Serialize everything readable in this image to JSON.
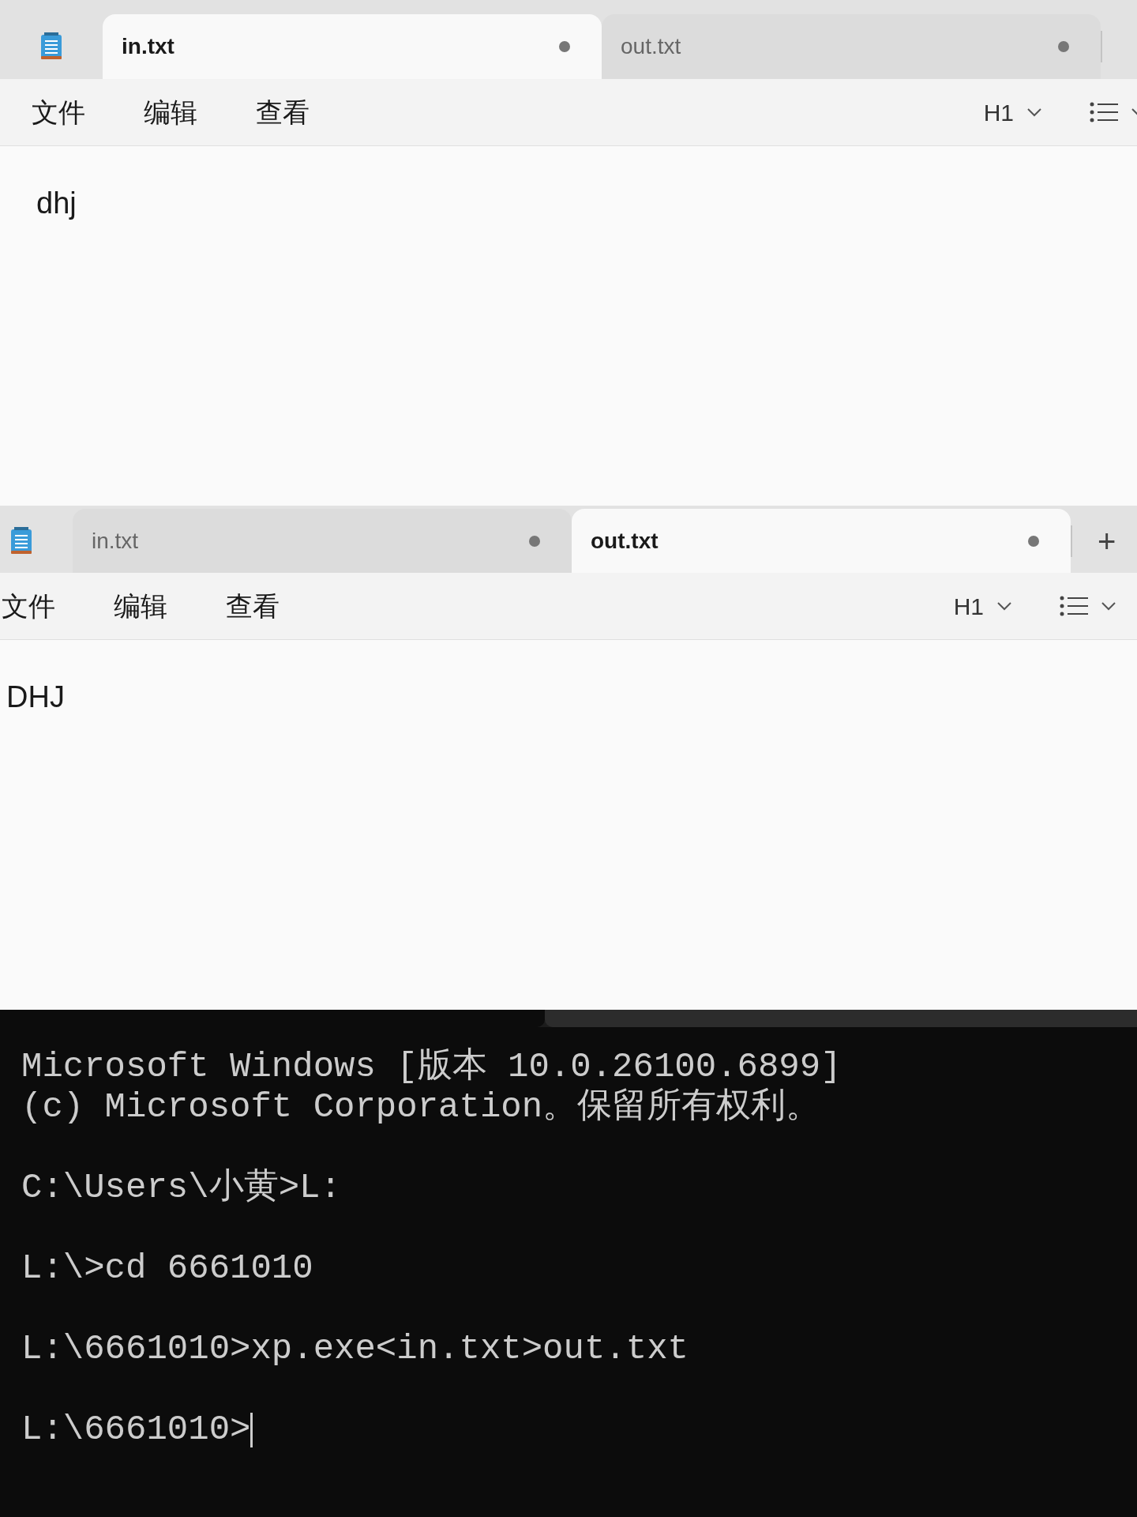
{
  "notepad_windows": [
    {
      "tabs": [
        {
          "label": "in.txt",
          "selected": true,
          "modified": true
        },
        {
          "label": "out.txt",
          "selected": false,
          "modified": true
        }
      ],
      "menu": [
        "文件",
        "编辑",
        "查看"
      ],
      "heading_selector": "H1",
      "content": "dhj"
    },
    {
      "tabs": [
        {
          "label": "in.txt",
          "selected": false,
          "modified": true
        },
        {
          "label": "out.txt",
          "selected": true,
          "modified": true
        }
      ],
      "new_tab_label": "+",
      "menu": [
        "文件",
        "编辑",
        "查看"
      ],
      "heading_selector": "H1",
      "content": "DHJ"
    }
  ],
  "terminal": {
    "lines": [
      {
        "text": "Microsoft Windows [版本 10.0.26100.6899]",
        "blank_after": false
      },
      {
        "text": "(c) Microsoft Corporation。保留所有权利。",
        "blank_after": true
      },
      {
        "text": "C:\\Users\\小黄>L:",
        "blank_after": true
      },
      {
        "text": "L:\\>cd 6661010",
        "blank_after": true
      },
      {
        "text": "L:\\6661010>xp.exe<in.txt>out.txt",
        "blank_after": true
      },
      {
        "text": "L:\\6661010>",
        "blank_after": false
      }
    ],
    "cursor_visible": true
  }
}
